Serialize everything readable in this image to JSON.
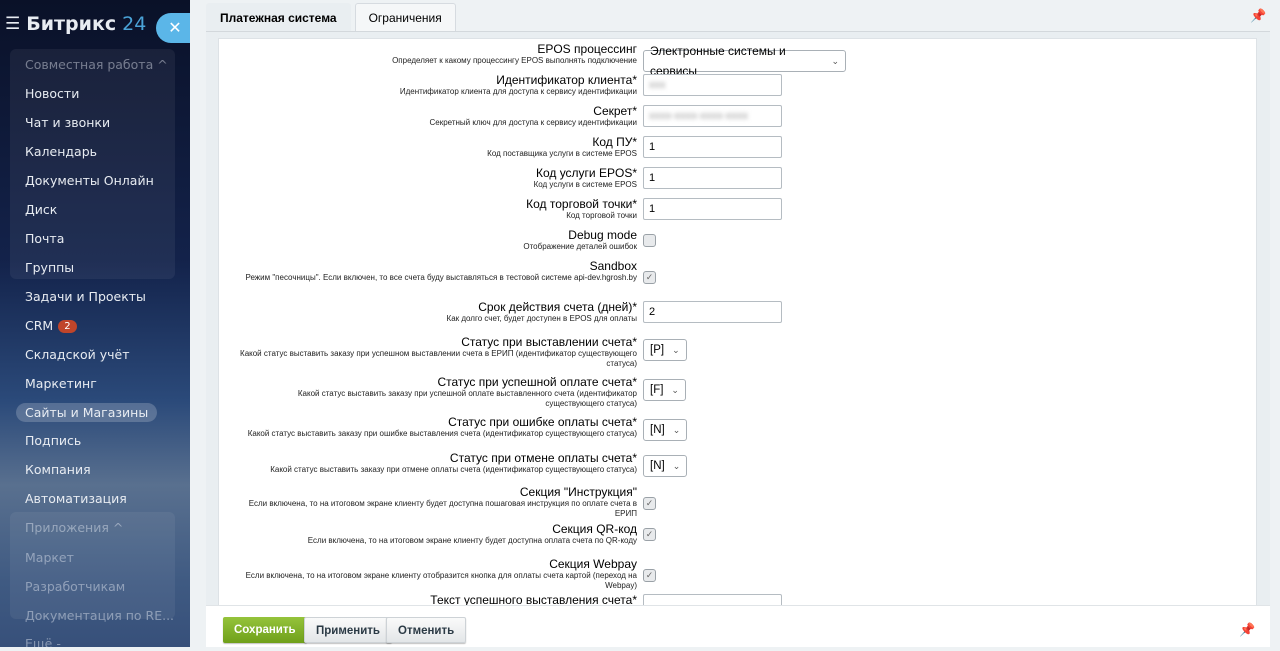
{
  "sidebar": {
    "logo_main": "Битрикс",
    "logo_num": "24",
    "items": [
      {
        "label": "Совместная работа ^",
        "dim": true
      },
      {
        "label": "Новости"
      },
      {
        "label": "Чат и звонки"
      },
      {
        "label": "Календарь"
      },
      {
        "label": "Документы Онлайн"
      },
      {
        "label": "Диск"
      },
      {
        "label": "Почта"
      },
      {
        "label": "Группы"
      },
      {
        "label": "Задачи и Проекты"
      },
      {
        "label": "CRM",
        "badge": "2"
      },
      {
        "label": "Складской учёт"
      },
      {
        "label": "Маркетинг"
      },
      {
        "label": "Сайты и Магазины",
        "active": true
      },
      {
        "label": "Подпись"
      },
      {
        "label": "Компания"
      },
      {
        "label": "Автоматизация"
      },
      {
        "label": "Приложения ^",
        "dim": true
      },
      {
        "label": "Маркет",
        "dim": true
      },
      {
        "label": "Разработчикам",
        "dim": true
      },
      {
        "label": "Документация по RE...",
        "dim": true
      },
      {
        "label": "Ещё -",
        "dim": true
      }
    ]
  },
  "tabs": [
    {
      "label": "Платежная система",
      "active": true
    },
    {
      "label": "Ограничения"
    }
  ],
  "fields": [
    {
      "label": "EPOS процессинг",
      "desc": "Определяет к какому процессингу EPOS выполнять подключение",
      "type": "select-wide",
      "value": "Электронные системы и сервисы"
    },
    {
      "label": "Идентификатор клиента*",
      "desc": "Идентификатор клиента для доступа к сервису идентификации",
      "type": "blur"
    },
    {
      "label": "Секрет*",
      "desc": "Секретный ключ для доступа к сервису идентификации",
      "type": "blur"
    },
    {
      "label": "Код ПУ*",
      "desc": "Код поставщика услуги в системе EPOS",
      "type": "text",
      "value": "1"
    },
    {
      "label": "Код услуги EPOS*",
      "desc": "Код услуги в системе EPOS",
      "type": "text",
      "value": "1"
    },
    {
      "label": "Код торговой точки*",
      "desc": "Код торговой точки",
      "type": "text",
      "value": "1"
    },
    {
      "label": "Debug mode",
      "desc": "Отображение деталей ошибок",
      "type": "check",
      "checked": false
    },
    {
      "label": "Sandbox",
      "desc": "Режим \"песочницы\". Если включен, то все счета буду выставляться в тестовой системе api-dev.hgrosh.by",
      "type": "check",
      "checked": true
    },
    {
      "label": "Срок действия счета (дней)*",
      "desc": "Как долго счет, будет доступен в EPOS для оплаты",
      "type": "text",
      "value": "2"
    },
    {
      "label": "Статус при выставлении счета*",
      "desc": "Какой статус выставить заказу при успешном выставлении счета в ЕРИП (идентификатор существующего статуса)",
      "type": "select",
      "value": "[P]"
    },
    {
      "label": "Статус при успешной оплате счета*",
      "desc": "Какой статус выставить заказу при успешной оплате выставленного счета (идентификатор существующего статуса)",
      "type": "select",
      "value": "[F]"
    },
    {
      "label": "Статус при ошибке оплаты счета*",
      "desc": "Какой статус выставить заказу при ошибке выставления счета (идентификатор существующего статуса)",
      "type": "select",
      "value": "[N]"
    },
    {
      "label": "Статус при отмене оплаты счета*",
      "desc": "Какой статус выставить заказу при отмене оплаты счета (идентификатор существующего статуса)",
      "type": "select",
      "value": "[N]"
    },
    {
      "label": "Секция \"Инструкция\"",
      "desc": "Если включена, то на итоговом экране клиенту будет доступна пошаговая инструкция по оплате счета в ЕРИП",
      "type": "check",
      "checked": true
    },
    {
      "label": "Секция QR-код",
      "desc": "Если включена, то на итоговом экране клиенту будет доступна оплата счета по QR-коду",
      "type": "check",
      "checked": true
    },
    {
      "label": "Секция Webpay",
      "desc": "Если включена, то на итоговом экране клиенту отобразится кнопка для оплаты счета картой (переход на Webpay)",
      "type": "check",
      "checked": true
    },
    {
      "label": "Текст успешного выставления счета*",
      "desc": "",
      "type": "text",
      "value": ""
    }
  ],
  "footer": {
    "save": "Сохранить",
    "apply": "Применить",
    "cancel": "Отменить"
  }
}
